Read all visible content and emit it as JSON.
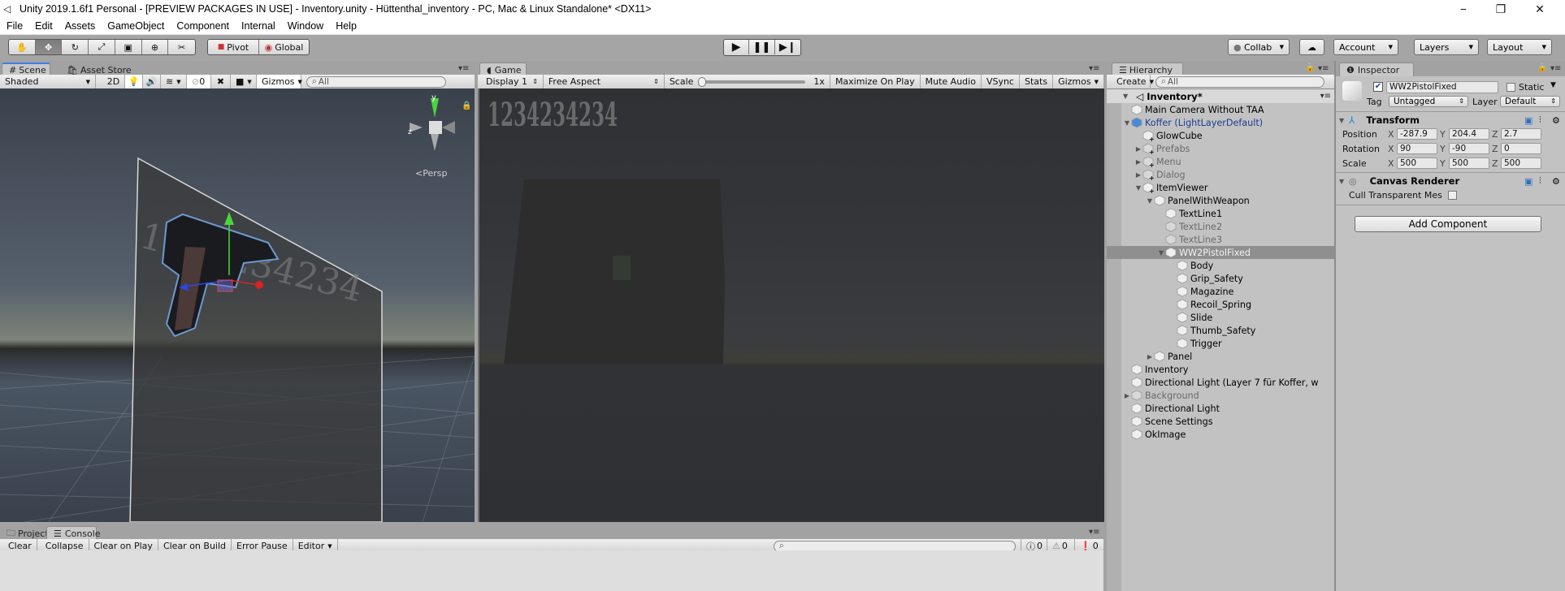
{
  "window": {
    "title": "Unity 2019.1.6f1 Personal - [PREVIEW PACKAGES IN USE] - Inventory.unity - Hüttenthal_inventory - PC, Mac & Linux Standalone* <DX11>",
    "controls": [
      "minimize",
      "restore",
      "close"
    ]
  },
  "menubar": [
    "File",
    "Edit",
    "Assets",
    "GameObject",
    "Component",
    "Internal",
    "Window",
    "Help"
  ],
  "toolbar": {
    "tools": [
      "hand-tool",
      "move-tool",
      "rotate-tool",
      "scale-tool",
      "rect-tool",
      "transform-tool",
      "custom-tool"
    ],
    "active_tool": "move-tool",
    "pivot_label": "Pivot",
    "global_label": "Global",
    "play_controls": [
      "play",
      "pause",
      "step"
    ],
    "collab_label": "Collab",
    "account_label": "Account",
    "layers_label": "Layers",
    "layout_label": "Layout"
  },
  "scene": {
    "tabs": [
      {
        "label": "Scene",
        "active": true
      },
      {
        "label": "Asset Store",
        "active": false
      }
    ],
    "shading_mode": "Shaded",
    "mode_2d": "2D",
    "hidden_count": "0",
    "gizmos_label": "Gizmos",
    "search_placeholder": "All",
    "projection_label": "Persp",
    "overlay_text": "1234234234"
  },
  "game": {
    "tab_label": "Game",
    "display": "Display 1",
    "aspect": "Free Aspect",
    "scale_label": "Scale",
    "scale_value": "1x",
    "scale_fraction": 0.0,
    "buttons": [
      "Maximize On Play",
      "Mute Audio",
      "VSync",
      "Stats",
      "Gizmos"
    ],
    "overlay_text": "1234234234"
  },
  "hierarchy": {
    "tab_label": "Hierarchy",
    "create_label": "Create",
    "search_placeholder": "All",
    "scene_name": "Inventory*",
    "items": [
      {
        "label": "Main Camera Without TAA",
        "depth": 0,
        "arrow": "",
        "style": "normal",
        "icon": "cube"
      },
      {
        "label": "Koffer (LightLayerDefault)",
        "depth": 0,
        "arrow": "open",
        "style": "prefab",
        "icon": "prefab"
      },
      {
        "label": "GlowCube",
        "depth": 1,
        "arrow": "",
        "style": "normal",
        "icon": "cube-plus"
      },
      {
        "label": "Prefabs",
        "depth": 1,
        "arrow": "closed",
        "style": "inactive",
        "icon": "cube-plus"
      },
      {
        "label": "Menu",
        "depth": 1,
        "arrow": "closed",
        "style": "inactive",
        "icon": "cube-plus"
      },
      {
        "label": "Dialog",
        "depth": 1,
        "arrow": "closed",
        "style": "inactive",
        "icon": "cube-plus"
      },
      {
        "label": "ItemViewer",
        "depth": 1,
        "arrow": "open",
        "style": "normal",
        "icon": "cube-plus"
      },
      {
        "label": "PanelWithWeapon",
        "depth": 2,
        "arrow": "open",
        "style": "normal",
        "icon": "cube"
      },
      {
        "label": "TextLine1",
        "depth": 3,
        "arrow": "",
        "style": "normal",
        "icon": "cube"
      },
      {
        "label": "TextLine2",
        "depth": 3,
        "arrow": "",
        "style": "inactive",
        "icon": "cube"
      },
      {
        "label": "TextLine3",
        "depth": 3,
        "arrow": "",
        "style": "inactive",
        "icon": "cube"
      },
      {
        "label": "WW2PistolFixed",
        "depth": 3,
        "arrow": "open",
        "style": "selected",
        "icon": "cube"
      },
      {
        "label": "Body",
        "depth": 4,
        "arrow": "",
        "style": "normal",
        "icon": "cube"
      },
      {
        "label": "Grip_Safety",
        "depth": 4,
        "arrow": "",
        "style": "normal",
        "icon": "cube"
      },
      {
        "label": "Magazine",
        "depth": 4,
        "arrow": "",
        "style": "normal",
        "icon": "cube"
      },
      {
        "label": "Recoil_Spring",
        "depth": 4,
        "arrow": "",
        "style": "normal",
        "icon": "cube"
      },
      {
        "label": "Slide",
        "depth": 4,
        "arrow": "",
        "style": "normal",
        "icon": "cube"
      },
      {
        "label": "Thumb_Safety",
        "depth": 4,
        "arrow": "",
        "style": "normal",
        "icon": "cube"
      },
      {
        "label": "Trigger",
        "depth": 4,
        "arrow": "",
        "style": "normal",
        "icon": "cube"
      },
      {
        "label": "Panel",
        "depth": 2,
        "arrow": "closed",
        "style": "normal",
        "icon": "cube"
      },
      {
        "label": "Inventory",
        "depth": 0,
        "arrow": "",
        "style": "normal",
        "icon": "cube"
      },
      {
        "label": "Directional Light (Layer 7 für Koffer, w",
        "depth": 0,
        "arrow": "",
        "style": "normal",
        "icon": "cube"
      },
      {
        "label": "Background",
        "depth": 0,
        "arrow": "closed",
        "style": "inactive",
        "icon": "cube"
      },
      {
        "label": "Directional Light",
        "depth": 0,
        "arrow": "",
        "style": "normal",
        "icon": "cube"
      },
      {
        "label": "Scene Settings",
        "depth": 0,
        "arrow": "",
        "style": "normal",
        "icon": "cube"
      },
      {
        "label": "OkImage",
        "depth": 0,
        "arrow": "",
        "style": "normal",
        "icon": "cube"
      }
    ]
  },
  "inspector": {
    "tab_label": "Inspector",
    "object_name": "WW2PistolFixed",
    "active": true,
    "static_label": "Static",
    "static": false,
    "tag_label": "Tag",
    "tag_value": "Untagged",
    "layer_label": "Layer",
    "layer_value": "Default",
    "transform": {
      "title": "Transform",
      "rows": [
        {
          "label": "Position",
          "x": "-287.9",
          "y": "204.4",
          "z": "2.7"
        },
        {
          "label": "Rotation",
          "x": "90",
          "y": "-90",
          "z": "0"
        },
        {
          "label": "Scale",
          "x": "500",
          "y": "500",
          "z": "500"
        }
      ],
      "axis_labels": [
        "X",
        "Y",
        "Z"
      ]
    },
    "canvas_renderer": {
      "title": "Canvas Renderer",
      "cull_label": "Cull Transparent Mes",
      "cull_checked": false
    },
    "add_component_label": "Add Component"
  },
  "console": {
    "tabs": [
      {
        "label": "Project",
        "active": false
      },
      {
        "label": "Console",
        "active": true
      }
    ],
    "buttons": [
      "Clear",
      "Collapse",
      "Clear on Play",
      "Clear on Build",
      "Error Pause"
    ],
    "editor_dropdown": "Editor",
    "search_placeholder": "",
    "info_count": "0",
    "warning_count": "0",
    "error_count": "0"
  }
}
